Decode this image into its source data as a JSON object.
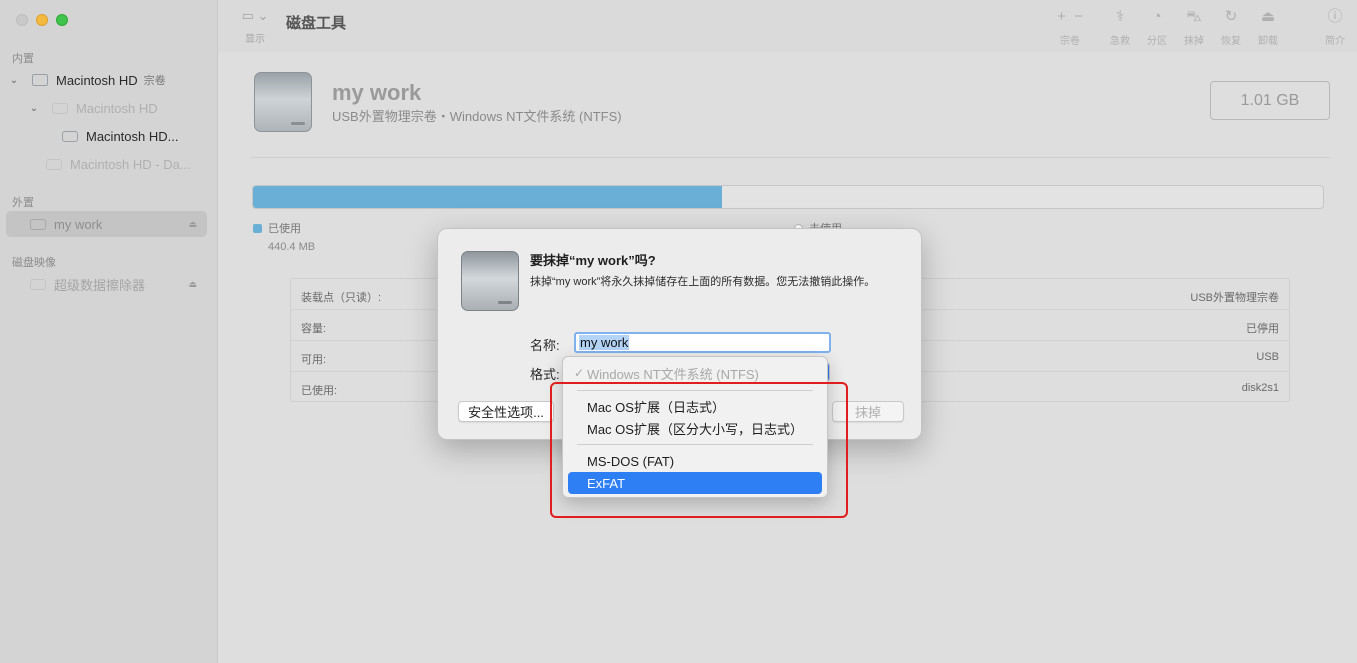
{
  "sidebar": {
    "internal_title": "内置",
    "external_title": "外置",
    "images_title": "磁盘映像",
    "items": [
      {
        "label": "Macintosh HD",
        "tag": "宗卷"
      },
      {
        "label": "Macintosh HD"
      },
      {
        "label": "Macintosh HD..."
      },
      {
        "label": "Macintosh HD - Da..."
      },
      {
        "label": "my work"
      },
      {
        "label": "超级数据擦除器"
      }
    ]
  },
  "toolbar": {
    "view_label": "显示",
    "app_title": "磁盘工具",
    "buttons": [
      {
        "label": "宗卷",
        "icon": "plus-minus-icon"
      },
      {
        "label": "急救",
        "icon": "stethoscope-icon"
      },
      {
        "label": "分区",
        "icon": "pie-icon"
      },
      {
        "label": "抹掉",
        "icon": "erase-icon"
      },
      {
        "label": "恢复",
        "icon": "restore-icon"
      },
      {
        "label": "卸载",
        "icon": "unmount-icon"
      },
      {
        "label": "简介",
        "icon": "info-icon"
      }
    ]
  },
  "volume": {
    "name": "my work",
    "subtitle": "USB外置物理宗卷・Windows NT文件系统 (NTFS)",
    "size": "1.01 GB",
    "used_fraction": 0.438,
    "used_label": "已使用",
    "used_value": "440.4 MB",
    "free_label": "未使用",
    "used_color": "#69afd6"
  },
  "info": {
    "rows": [
      {
        "key": "装载点（只读）:",
        "value": "USB外置物理宗卷"
      },
      {
        "key": "容量:",
        "value": "已停用"
      },
      {
        "key": "可用:",
        "value": "USB"
      },
      {
        "key": "已使用:",
        "value": "disk2s1"
      }
    ]
  },
  "dialog": {
    "title": "要抹掉“my work”吗?",
    "message": "抹掉“my work”将永久抹掉储存在上面的所有数据。您无法撤销此操作。",
    "name_label": "名称:",
    "name_value": "my work",
    "format_label": "格式:",
    "security_button": "安全性选项...",
    "erase_button": "抹掉"
  },
  "menu": {
    "checked_item": "Windows NT文件系统 (NTFS)",
    "items": [
      "Mac OS扩展（日志式）",
      "Mac OS扩展（区分大小写，日志式）",
      "MS-DOS (FAT)",
      "ExFAT"
    ],
    "highlight_color": "#2f7ff4"
  }
}
